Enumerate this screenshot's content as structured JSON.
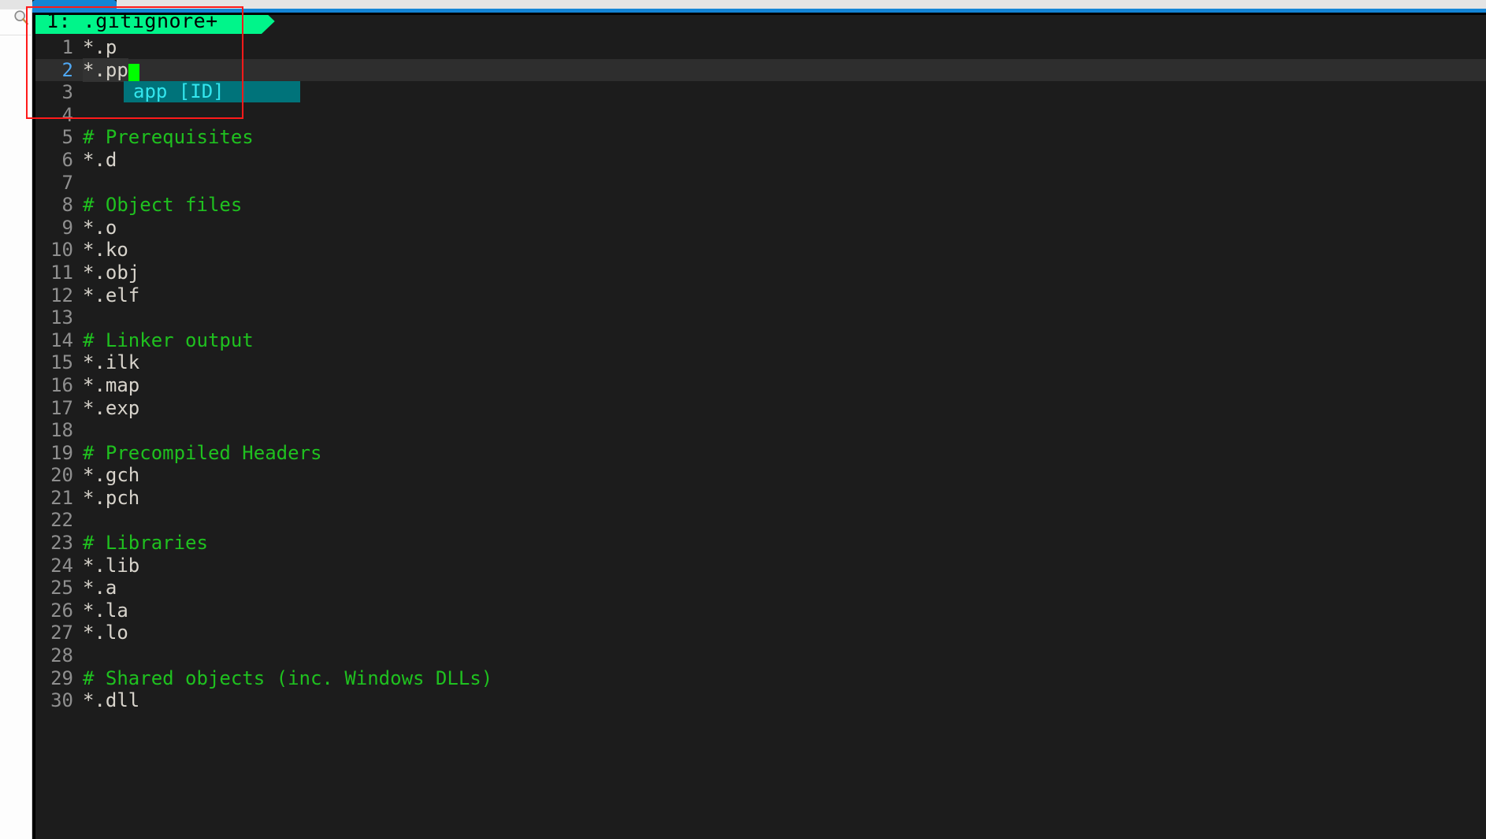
{
  "window": {
    "background": "#1c1c1c",
    "accent_blue": "#1485d6"
  },
  "left_panel": {
    "search_icon": "search-icon"
  },
  "browser_tab": {
    "label": ""
  },
  "editor": {
    "header": {
      "text": "1: .gitignore+",
      "background": "#00f58a",
      "foreground": "#000000"
    },
    "cursor": {
      "line": 2,
      "color": "#00ff00"
    },
    "selection_color": "#333333",
    "comment_color": "#1fc11f",
    "text_color": "#d8d4cc",
    "lineno_color": "#8f8f8f",
    "current_lineno_color": "#4fa8f5",
    "lines": [
      {
        "no": "1",
        "text": "*.p",
        "kind": "text"
      },
      {
        "no": "2",
        "text": "*.pp",
        "kind": "current"
      },
      {
        "no": "3",
        "text": "",
        "kind": "text"
      },
      {
        "no": "4",
        "text": "",
        "kind": "text"
      },
      {
        "no": "5",
        "text": "# Prerequisites",
        "kind": "comment"
      },
      {
        "no": "6",
        "text": "*.d",
        "kind": "text"
      },
      {
        "no": "7",
        "text": "",
        "kind": "text"
      },
      {
        "no": "8",
        "text": "# Object files",
        "kind": "comment"
      },
      {
        "no": "9",
        "text": "*.o",
        "kind": "text"
      },
      {
        "no": "10",
        "text": "*.ko",
        "kind": "text"
      },
      {
        "no": "11",
        "text": "*.obj",
        "kind": "text"
      },
      {
        "no": "12",
        "text": "*.elf",
        "kind": "text"
      },
      {
        "no": "13",
        "text": "",
        "kind": "text"
      },
      {
        "no": "14",
        "text": "# Linker output",
        "kind": "comment"
      },
      {
        "no": "15",
        "text": "*.ilk",
        "kind": "text"
      },
      {
        "no": "16",
        "text": "*.map",
        "kind": "text"
      },
      {
        "no": "17",
        "text": "*.exp",
        "kind": "text"
      },
      {
        "no": "18",
        "text": "",
        "kind": "text"
      },
      {
        "no": "19",
        "text": "# Precompiled Headers",
        "kind": "comment"
      },
      {
        "no": "20",
        "text": "*.gch",
        "kind": "text"
      },
      {
        "no": "21",
        "text": "*.pch",
        "kind": "text"
      },
      {
        "no": "22",
        "text": "",
        "kind": "text"
      },
      {
        "no": "23",
        "text": "# Libraries",
        "kind": "comment"
      },
      {
        "no": "24",
        "text": "*.lib",
        "kind": "text"
      },
      {
        "no": "25",
        "text": "*.a",
        "kind": "text"
      },
      {
        "no": "26",
        "text": "*.la",
        "kind": "text"
      },
      {
        "no": "27",
        "text": "*.lo",
        "kind": "text"
      },
      {
        "no": "28",
        "text": "",
        "kind": "text"
      },
      {
        "no": "29",
        "text": "# Shared objects (inc. Windows DLLs)",
        "kind": "comment"
      },
      {
        "no": "30",
        "text": "*.dll",
        "kind": "text"
      }
    ]
  },
  "autocomplete": {
    "visible": true,
    "background": "#00737a",
    "foreground": "#33e6ee",
    "items": [
      {
        "label": "app [ID]"
      }
    ]
  },
  "annotation": {
    "color": "#ff1a1a"
  }
}
